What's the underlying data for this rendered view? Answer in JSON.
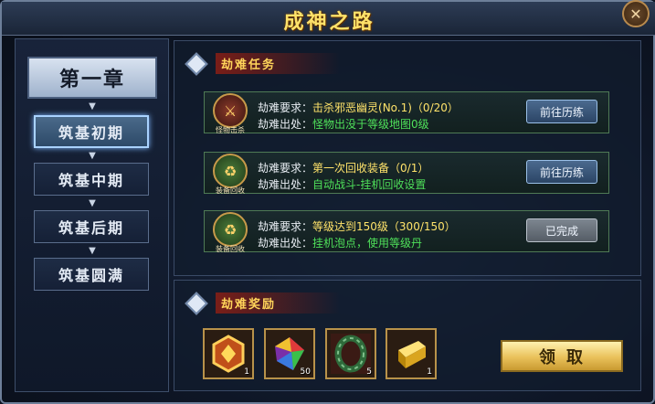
{
  "window": {
    "title": "成神之路",
    "close_symbol": "✕"
  },
  "chapter": {
    "label": "第一章"
  },
  "stages": [
    {
      "label": "筑基初期",
      "active": true
    },
    {
      "label": "筑基中期",
      "active": false
    },
    {
      "label": "筑基后期",
      "active": false
    },
    {
      "label": "筑基圆满",
      "active": false
    }
  ],
  "tasks_section": {
    "title": "劫难任务"
  },
  "tasks": [
    {
      "icon_caption": "怪物击杀",
      "icon": "sword-shield-icon",
      "req_label": "劫难要求：",
      "req_value": "击杀邪恶幽灵(No.1)（0/20）",
      "src_label": "劫难出处：",
      "src_value": "怪物出没于等级地图0级",
      "button": "前往历练"
    },
    {
      "icon_caption": "装备回收",
      "icon": "recycle-icon",
      "req_label": "劫难要求：",
      "req_value": "第一次回收装备（0/1）",
      "src_label": "劫难出处：",
      "src_value": "自动战斗-挂机回收设置",
      "button": "前往历练"
    },
    {
      "icon_caption": "装备回收",
      "icon": "recycle-icon",
      "req_label": "劫难要求：",
      "req_value": "等级达到150级（300/150）",
      "src_label": "劫难出处：",
      "src_value": "挂机泡点，使用等级丹",
      "button": "已完成"
    }
  ],
  "rewards_section": {
    "title": "劫难奖励"
  },
  "rewards": [
    {
      "icon": "level-badge-icon",
      "count": "1"
    },
    {
      "icon": "rainbow-gem-icon",
      "count": "50"
    },
    {
      "icon": "bracelet-icon",
      "count": "5"
    },
    {
      "icon": "gold-bar-icon",
      "count": "1"
    }
  ],
  "claim_button": "领取",
  "colors": {
    "title": "#ffe26a",
    "requirement": "#ffe36a",
    "source": "#4fe05a",
    "section_title": "#ffd45a"
  }
}
